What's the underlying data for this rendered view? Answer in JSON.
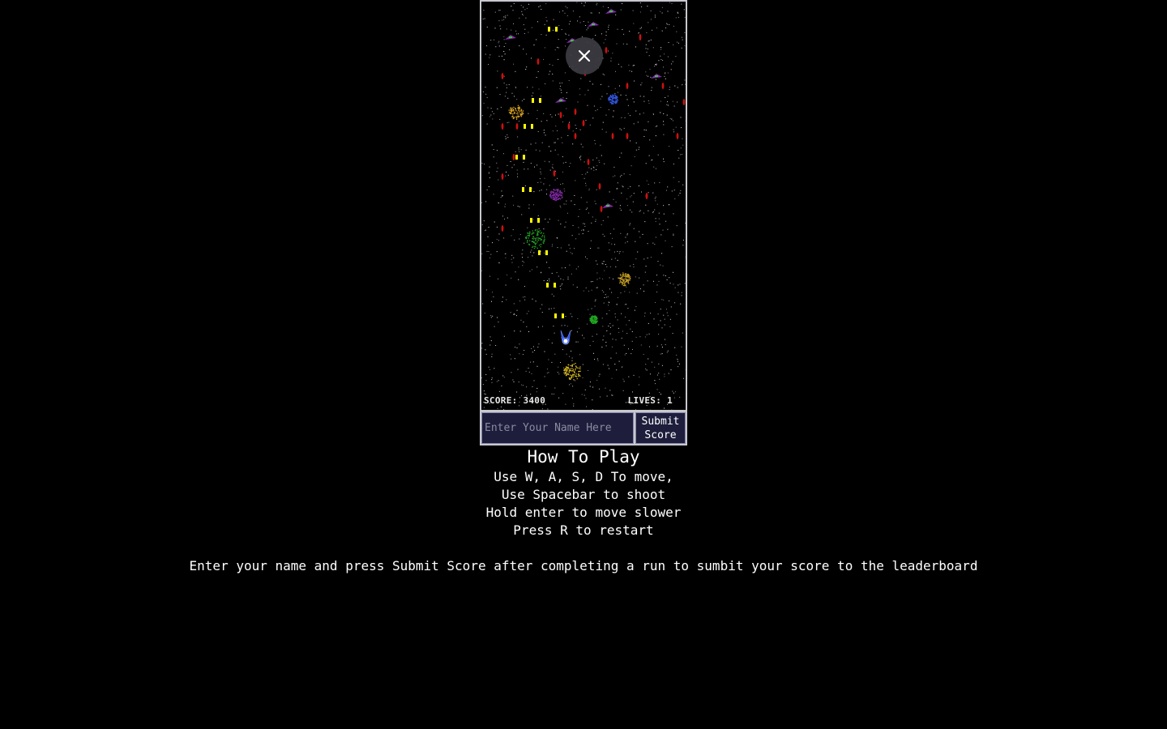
{
  "game": {
    "score_text": "SCORE: 3400",
    "lives_text": "LIVES: 1",
    "close_glyph": "×"
  },
  "submit": {
    "placeholder": "Enter Your Name Here",
    "value": "",
    "button_label": "Submit\nScore"
  },
  "instructions": {
    "title": "How To Play",
    "lines": [
      "Use W, A, S, D To move,",
      "Use Spacebar to shoot",
      "Hold enter to move slower",
      "Press R to restart"
    ],
    "note": "Enter your name and press Submit Score after completing a run to sumbit your score to the leaderboard"
  },
  "colors": {
    "background": "#000000",
    "frame_border": "#c8c8d0",
    "input_bg": "#1e1e3c",
    "bullet": "#ffff00",
    "enemy_bullet": "#cc1111",
    "player": "#3355ff"
  },
  "icons": {
    "close": "close-icon",
    "player_ship": "player-ship-icon"
  }
}
